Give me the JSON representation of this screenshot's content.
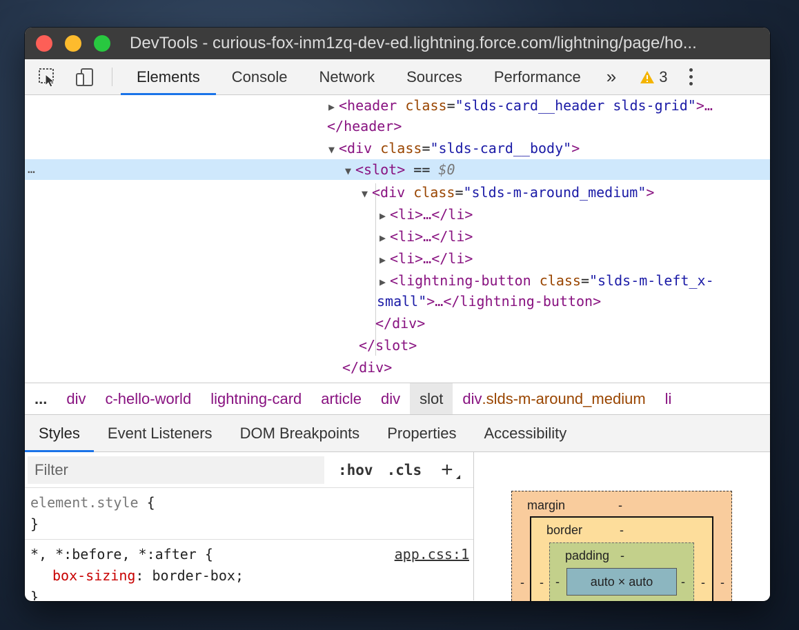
{
  "window": {
    "title": "DevTools - curious-fox-inm1zq-dev-ed.lightning.force.com/lightning/page/ho..."
  },
  "toolbar": {
    "tabs": [
      "Elements",
      "Console",
      "Network",
      "Sources",
      "Performance"
    ],
    "more_label": "»",
    "warning_count": "3"
  },
  "dom": {
    "lines": [
      {
        "open": "<header",
        "attr": "class",
        "val": "\"slds-card__header slds-grid\"",
        "close": ">…"
      },
      {
        "text": "</header>"
      },
      {
        "open": "<div",
        "attr": "class",
        "val": "\"slds-card__body\"",
        "close": ">"
      },
      {
        "open": "<slot>",
        "suffix": " == ",
        "var": "$0"
      },
      {
        "open": "<div",
        "attr": "class",
        "val": "\"slds-m-around_medium\"",
        "close": ">"
      },
      {
        "text": "<li>…</li>"
      },
      {
        "text": "<li>…</li>"
      },
      {
        "text": "<li>…</li>"
      },
      {
        "open": "<lightning-button",
        "attr": "class",
        "val": "\"slds-m-left_x-"
      },
      {
        "val": "small\"",
        "close": ">…</lightning-button>"
      },
      {
        "text": "</div>"
      },
      {
        "text": "</slot>"
      },
      {
        "text": "</div>"
      }
    ],
    "gutter_dots": "…"
  },
  "breadcrumbs": {
    "overflow": "...",
    "items": [
      "div",
      "c-hello-world",
      "lightning-card",
      "article",
      "div",
      "slot"
    ],
    "cls_tag": "div",
    "cls_name": ".slds-m-around_medium",
    "last": "li"
  },
  "subtabs": [
    "Styles",
    "Event Listeners",
    "DOM Breakpoints",
    "Properties",
    "Accessibility"
  ],
  "styles": {
    "filter_placeholder": "Filter",
    "hov": ":hov",
    "cls": ".cls",
    "add": "+",
    "element_style_selector": "element.style",
    "open_brace": " {",
    "close_brace": "}",
    "rule2_selector": "*, *:before, *:after",
    "rule2_source": "app.css:1",
    "rule2_prop": "box-sizing",
    "rule2_value": "border-box"
  },
  "box_model": {
    "margin_label": "margin",
    "border_label": "border",
    "padding_label": "padding",
    "dash": "-",
    "content_size": "auto × auto"
  },
  "colors": {
    "accent": "#1a73e8",
    "selected_row": "#cfe8fc",
    "tag": "#881280",
    "attr": "#994500",
    "value": "#1a1aa6"
  }
}
